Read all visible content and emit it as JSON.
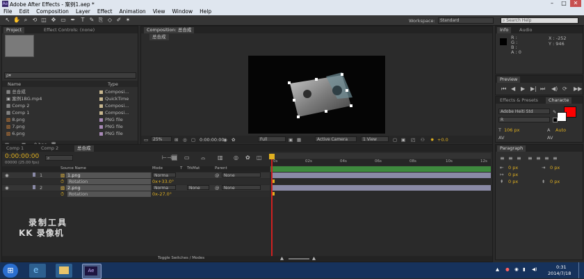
{
  "window": {
    "title": "Adobe After Effects - 案例1.aep *",
    "app_icon": "Ae"
  },
  "menu": [
    "File",
    "Edit",
    "Composition",
    "Layer",
    "Effect",
    "Animation",
    "View",
    "Window",
    "Help"
  ],
  "workspace": {
    "label": "Workspace:",
    "value": "Standard"
  },
  "search_help": {
    "placeholder": "Search Help"
  },
  "project_panel": {
    "tabs": [
      "Project",
      "Effect Controls: (none)"
    ],
    "search_placeholder": "ρ▾",
    "columns": [
      "Name",
      "Type"
    ],
    "items": [
      {
        "name": "总合成",
        "type": "Composi...",
        "color": "#c9b890"
      },
      {
        "name": "案例1BG.mp4",
        "type": "QuickTime",
        "color": "#c9b890"
      },
      {
        "name": "Comp 2",
        "type": "Composi...",
        "color": "#c9b890"
      },
      {
        "name": "Comp 1",
        "type": "Composi...",
        "color": "#c9b890"
      },
      {
        "name": "8.png",
        "type": "PNG file",
        "color": "#a98ab8"
      },
      {
        "name": "7.png",
        "type": "PNG file",
        "color": "#a98ab8"
      },
      {
        "name": "6.png",
        "type": "PNG file",
        "color": "#a98ab8"
      }
    ],
    "bpc": "8 bpc"
  },
  "composition_panel": {
    "tab": "Composition: 总合成",
    "subtab": "总合成",
    "zoom": "25%",
    "timecode": "0:00:00:00",
    "resolution": "Full",
    "camera": "Active Camera",
    "view": "1 View",
    "exposure": "+0.0"
  },
  "info_panel": {
    "tabs": [
      "Info",
      "Audio"
    ],
    "r": "R :",
    "g": "G :",
    "b": "B :",
    "a": "A : 0",
    "x": "X : -252",
    "y": "Y : 946"
  },
  "preview_panel": {
    "tab": "Preview"
  },
  "character_panel": {
    "tabs": [
      "Effects & Presets",
      "Characte"
    ],
    "font": "Adobe Heiti Std",
    "style": "R",
    "size": "106 px",
    "leading": "Auto",
    "fill_color": "#ff0000"
  },
  "paragraph_panel": {
    "tab": "Paragraph",
    "indents": [
      "0 px",
      "0 px",
      "0 px",
      "0 px",
      "0 px"
    ]
  },
  "timeline": {
    "tabs": [
      "Comp 1",
      "Comp 2",
      "总合成"
    ],
    "timecode": "0:00:00:00",
    "frame_info": "00000 (25.00 fps)",
    "columns": {
      "source": "Source Name",
      "mode": "Mode",
      "t": "T",
      "trkmat": "TrkMat",
      "parent": "Parent"
    },
    "layers": [
      {
        "num": "1",
        "name": "1.png",
        "mode": "Norma",
        "trkmat": "",
        "parent": "None",
        "prop": "Rotation",
        "value": "0x+33.0°"
      },
      {
        "num": "2",
        "name": "2.png",
        "mode": "Norma",
        "trkmat": "None",
        "parent": "None",
        "prop": "Rotation",
        "value": "0x-27.0°"
      }
    ],
    "ruler": [
      "0s",
      "02s",
      "04s",
      "06s",
      "08s",
      "10s",
      "12s"
    ],
    "toggle_label": "Toggle Switches / Modes"
  },
  "watermark": {
    "line1": "录制工具",
    "line2": "KK 录像机"
  },
  "taskbar": {
    "time": "0:31",
    "date": "2014/7/18"
  }
}
